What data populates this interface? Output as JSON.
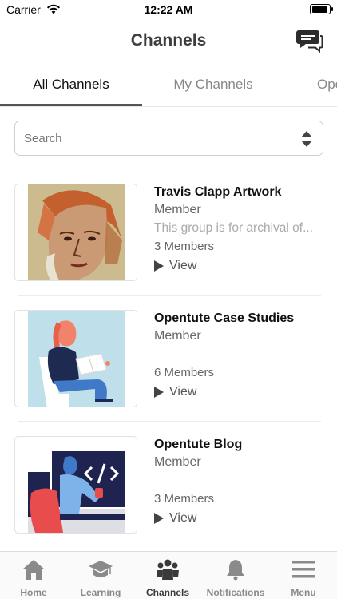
{
  "status_bar": {
    "carrier": "Carrier",
    "time": "12:22 AM"
  },
  "header": {
    "title": "Channels",
    "chat_icon": "chat-bubbles-icon"
  },
  "tabs": [
    {
      "label": "All Channels",
      "active": true
    },
    {
      "label": "My Channels",
      "active": false
    },
    {
      "label": "Ope",
      "active": false
    }
  ],
  "search": {
    "placeholder": "Search",
    "sort_icon": "sort-arrows-icon"
  },
  "channels": [
    {
      "title": "Travis Clapp Artwork",
      "role": "Member",
      "description": "This group is for archival of...",
      "members": "3 Members",
      "view_label": "View"
    },
    {
      "title": "Opentute Case Studies",
      "role": "Member",
      "description": "",
      "members": "6 Members",
      "view_label": "View"
    },
    {
      "title": "Opentute Blog",
      "role": "Member",
      "description": "",
      "members": "3 Members",
      "view_label": "View"
    }
  ],
  "bottom_nav": [
    {
      "label": "Home",
      "icon": "home-icon",
      "active": false
    },
    {
      "label": "Learning",
      "icon": "graduation-cap-icon",
      "active": false
    },
    {
      "label": "Channels",
      "icon": "people-icon",
      "active": true
    },
    {
      "label": "Notifications",
      "icon": "bell-icon",
      "active": false
    },
    {
      "label": "Menu",
      "icon": "hamburger-menu-icon",
      "active": false
    }
  ],
  "colors": {
    "active_text": "#111111",
    "inactive_text": "#888888",
    "nav_active": "#3a3a3a",
    "nav_inactive": "#8a8a8a"
  }
}
